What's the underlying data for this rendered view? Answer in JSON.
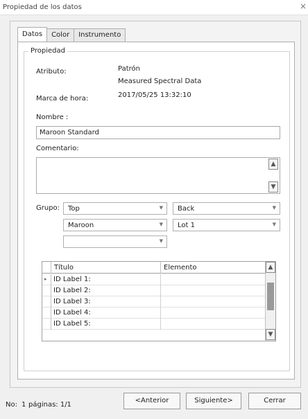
{
  "window": {
    "title": "Propiedad de los datos",
    "close_glyph": "×"
  },
  "tabs": [
    {
      "label": "Datos",
      "active": true
    },
    {
      "label": "Color",
      "active": false
    },
    {
      "label": "Instrumento",
      "active": false
    }
  ],
  "propiedad": {
    "legend": "Propiedad",
    "atributo_label": "Atributo:",
    "atributo_value": "Patrón",
    "atributo_value2": "Measured Spectral Data",
    "marca_label": "Marca de hora:",
    "marca_value": "2017/05/25 13:32:10",
    "nombre_label": "Nombre :",
    "nombre_value": "Maroon Standard",
    "comentario_label": "Comentario:",
    "comentario_value": "",
    "grupo_label": "Grupo:",
    "grupo": [
      "Top",
      "Back",
      "Maroon",
      "Lot 1",
      ""
    ]
  },
  "grid": {
    "columns": [
      "Título",
      "Elemento"
    ],
    "rows": [
      {
        "titulo": "ID Label 1:",
        "elemento": ""
      },
      {
        "titulo": "ID Label 2:",
        "elemento": ""
      },
      {
        "titulo": "ID Label 3:",
        "elemento": ""
      },
      {
        "titulo": "ID Label 4:",
        "elemento": ""
      },
      {
        "titulo": "ID Label 5:",
        "elemento": ""
      }
    ]
  },
  "footer": {
    "no_label": "No:",
    "no_value": "1",
    "paginas": "páginas: 1/1",
    "anterior": "<Anterior",
    "siguiente": "Siguiente>",
    "cerrar": "Cerrar"
  },
  "icons": {
    "scroll_up": "▲",
    "scroll_down": "▼",
    "dropdown": "▼",
    "row_pointer": "▸"
  }
}
